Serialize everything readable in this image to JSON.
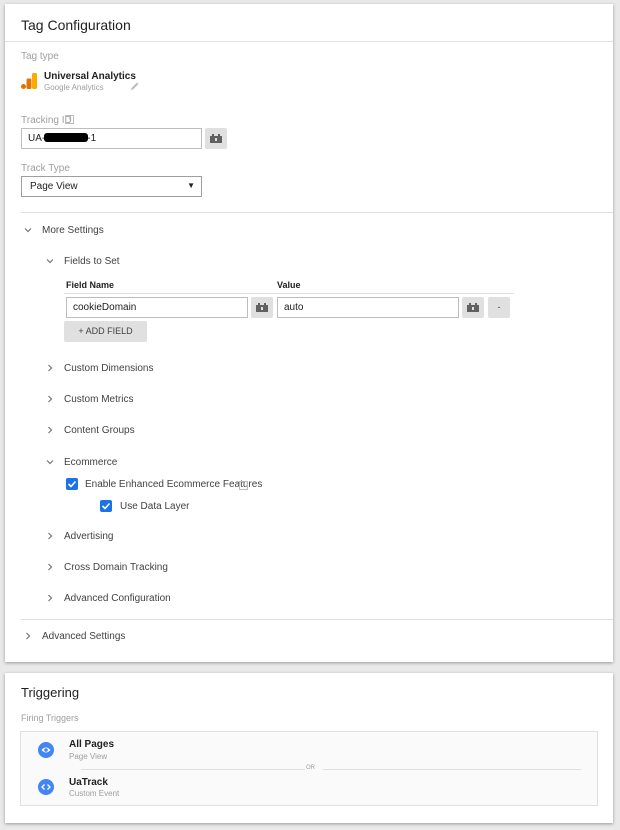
{
  "tag_card": {
    "title": "Tag Configuration",
    "tag_type_label": "Tag type",
    "tag_name": "Universal Analytics",
    "tag_vendor": "Google Analytics",
    "tracking_id_label": "Tracking ID",
    "help_mark": "?",
    "tracking_id_prefix": "UA-",
    "tracking_id_suffix": "-1",
    "track_type_label": "Track Type",
    "track_type_value": "Page View",
    "more_settings": "More Settings",
    "fields_to_set": "Fields to Set",
    "field_name_header": "Field Name",
    "value_header": "Value",
    "field_name_value": "cookieDomain",
    "field_value_value": "auto",
    "remove_label": "-",
    "add_field_label": "+ ADD FIELD",
    "sections": {
      "custom_dimensions": "Custom Dimensions",
      "custom_metrics": "Custom Metrics",
      "content_groups": "Content Groups",
      "ecommerce": "Ecommerce",
      "advertising": "Advertising",
      "cross_domain": "Cross Domain Tracking",
      "advanced_config": "Advanced Configuration"
    },
    "enhanced_ecommerce_label": "Enable Enhanced Ecommerce Features",
    "enhanced_ecommerce_checked": true,
    "use_data_layer_label": "Use Data Layer",
    "use_data_layer_checked": true,
    "advanced_settings": "Advanced Settings"
  },
  "trigger_card": {
    "title": "Triggering",
    "firing_label": "Firing Triggers",
    "or_label": "OR",
    "triggers": [
      {
        "name": "All Pages",
        "type": "Page View",
        "icon": "eye-icon"
      },
      {
        "name": "UaTrack",
        "type": "Custom Event",
        "icon": "code-icon"
      }
    ]
  },
  "colors": {
    "accent": "#1a73e8",
    "trigger_icon": "#4285f4",
    "analytics_orange": "#f9ab00",
    "analytics_dark_orange": "#e37400"
  }
}
